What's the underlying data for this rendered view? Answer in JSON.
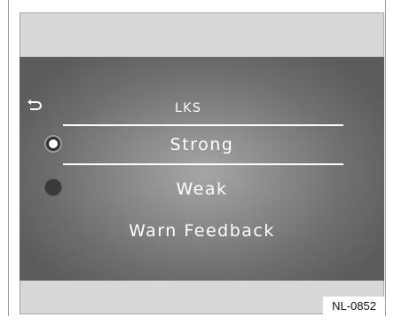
{
  "screen": {
    "title": "LKS",
    "back_icon": "back-arrow-icon"
  },
  "menu": {
    "items": [
      {
        "label": "Strong",
        "selected": true
      },
      {
        "label": "Weak",
        "selected": false
      },
      {
        "label": "Warn Feedback"
      }
    ]
  },
  "figure": {
    "code": "NL-0852"
  },
  "colors": {
    "page_background": "#ffffff",
    "panel_background": "#d8d8d8",
    "display_edge": "#5c5c5c",
    "display_center": "#a6a6a6",
    "text": "#ffffff"
  }
}
